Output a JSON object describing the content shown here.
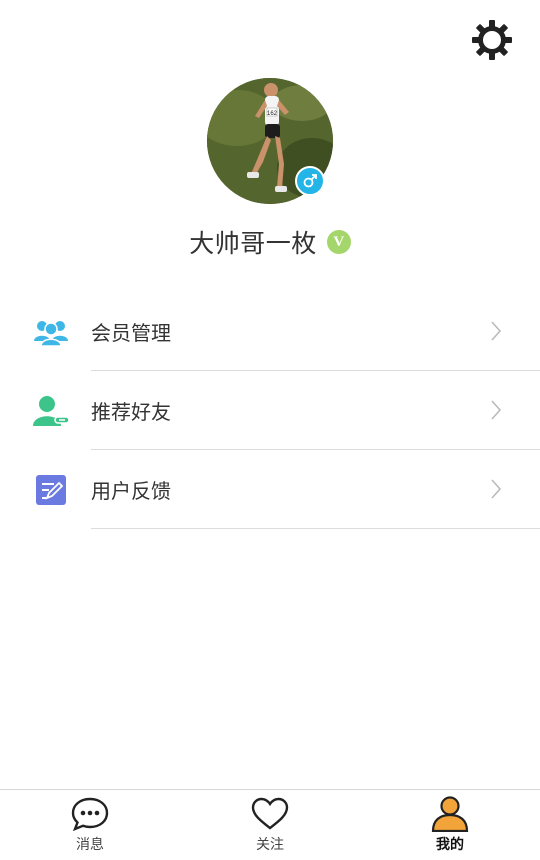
{
  "profile": {
    "username": "大帅哥一枚",
    "vip_badge": "V",
    "bib_number": "162"
  },
  "menu": {
    "items": [
      {
        "label": "会员管理",
        "icon": "members-icon",
        "color": "#3fb7e6"
      },
      {
        "label": "推荐好友",
        "icon": "add-friend-icon",
        "color": "#3dc48a"
      },
      {
        "label": "用户反馈",
        "icon": "feedback-icon",
        "color": "#6a7ae0"
      }
    ]
  },
  "tabbar": {
    "tabs": [
      {
        "label": "消息",
        "icon": "chat-bubble-icon",
        "active": false
      },
      {
        "label": "关注",
        "icon": "heart-icon",
        "active": false
      },
      {
        "label": "我的",
        "icon": "person-icon",
        "active": true
      }
    ],
    "active_color": "#f2a33a"
  }
}
